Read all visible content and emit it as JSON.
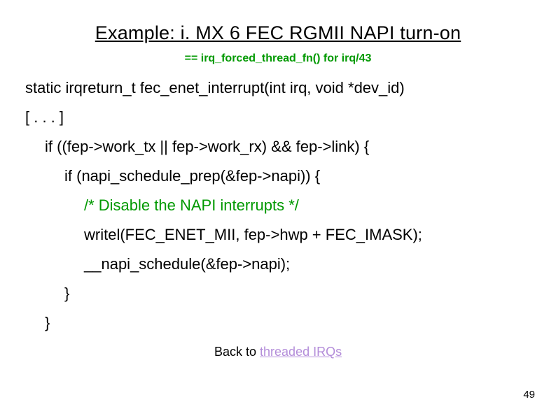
{
  "title": "Example: i. MX 6 FEC RGMII NAPI turn-on",
  "subtitle": "== irq_forced_thread_fn() for irq/43",
  "code": {
    "l1": "static irqreturn_t fec_enet_interrupt(int irq, void *dev_id)",
    "l2": "[ . . . ]",
    "l3": "if ((fep->work_tx || fep->work_rx) && fep->link) {",
    "l4": "if (napi_schedule_prep(&fep->napi)) {",
    "l5": "/* Disable the NAPI interrupts */",
    "l6": "writel(FEC_ENET_MII, fep->hwp + FEC_IMASK);",
    "l7": "__napi_schedule(&fep->napi);",
    "l8": "}",
    "l9": "}"
  },
  "back": {
    "prefix": "Back to ",
    "link": "threaded IRQs"
  },
  "page_number": "49"
}
